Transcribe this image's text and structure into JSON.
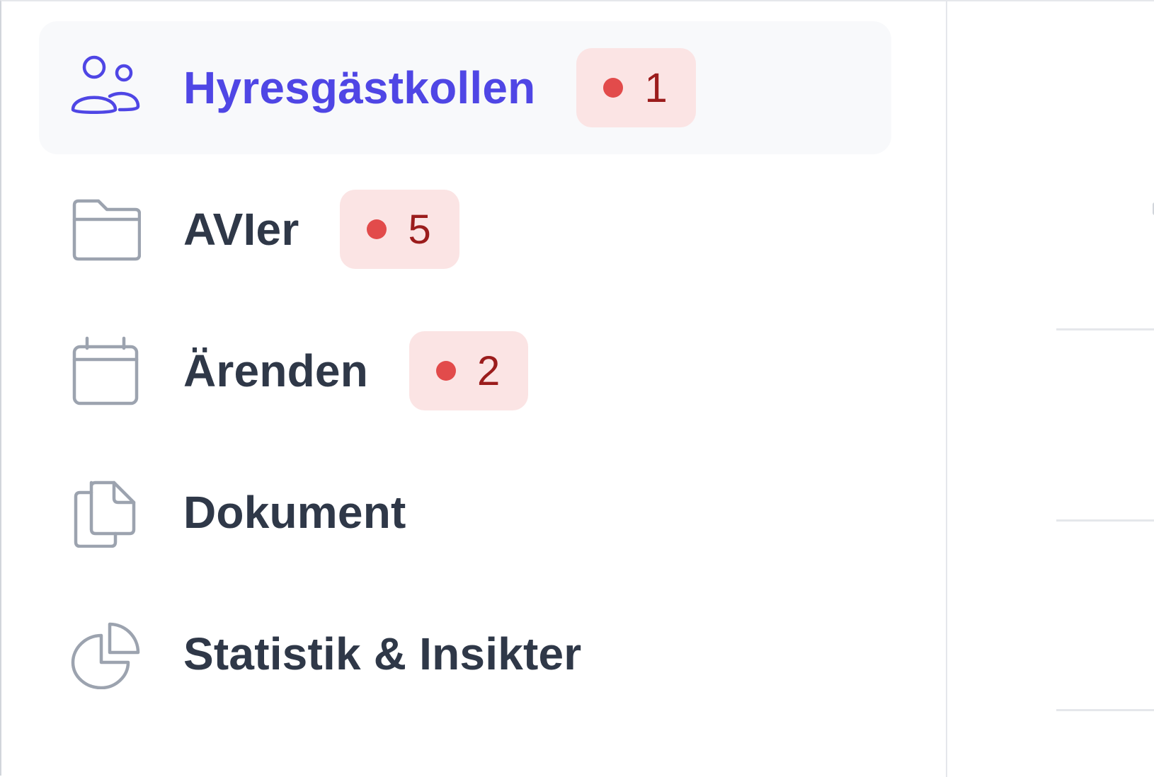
{
  "sidebar": {
    "items": [
      {
        "label": "Hyresgästkollen",
        "icon": "users-icon",
        "active": true,
        "badge": "1"
      },
      {
        "label": "AVIer",
        "icon": "folder-icon",
        "active": false,
        "badge": "5"
      },
      {
        "label": "Ärenden",
        "icon": "calendar-icon",
        "active": false,
        "badge": "2"
      },
      {
        "label": "Dokument",
        "icon": "documents-icon",
        "active": false
      },
      {
        "label": "Statistik & Insikter",
        "icon": "chart-pie-icon",
        "active": false
      }
    ]
  },
  "colors": {
    "active_text": "#4f46e5",
    "inactive_text": "#2f3848",
    "icon_inactive": "#9ca3af",
    "badge_bg": "#fbe4e4",
    "badge_dot": "#e24b4b",
    "badge_text": "#9b1c1c",
    "active_bg": "#f8f9fb"
  }
}
